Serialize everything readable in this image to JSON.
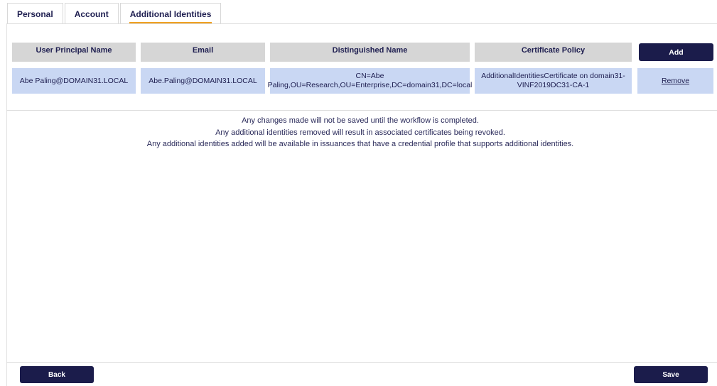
{
  "tabs": [
    {
      "label": "Personal",
      "active": false
    },
    {
      "label": "Account",
      "active": false
    },
    {
      "label": "Additional Identities",
      "active": true
    }
  ],
  "table": {
    "headers": [
      "User Principal Name",
      "Email",
      "Distinguished Name",
      "Certificate Policy"
    ],
    "add_label": "Add",
    "rows": [
      {
        "upn": "Abe Paling@DOMAIN31.LOCAL",
        "email": "Abe.Paling@DOMAIN31.LOCAL",
        "dn": "CN=Abe Paling,OU=Research,OU=Enterprise,DC=domain31,DC=local",
        "policy": "AdditionalIdentitiesCertificate on domain31-VINF2019DC31-CA-1",
        "action": "Remove"
      }
    ]
  },
  "notes": [
    "Any changes made will not be saved until the workflow is completed.",
    "Any additional identities removed will result in associated certificates being revoked.",
    "Any additional identities added will be available in issuances that have a credential profile that supports additional identities."
  ],
  "footer": {
    "back_label": "Back",
    "save_label": "Save"
  },
  "colors": {
    "accent": "#f0a020",
    "button": "#1b1c4b",
    "header_cell": "#d6d6d6",
    "data_cell": "#c9d7f3",
    "text": "#1e1e50"
  }
}
